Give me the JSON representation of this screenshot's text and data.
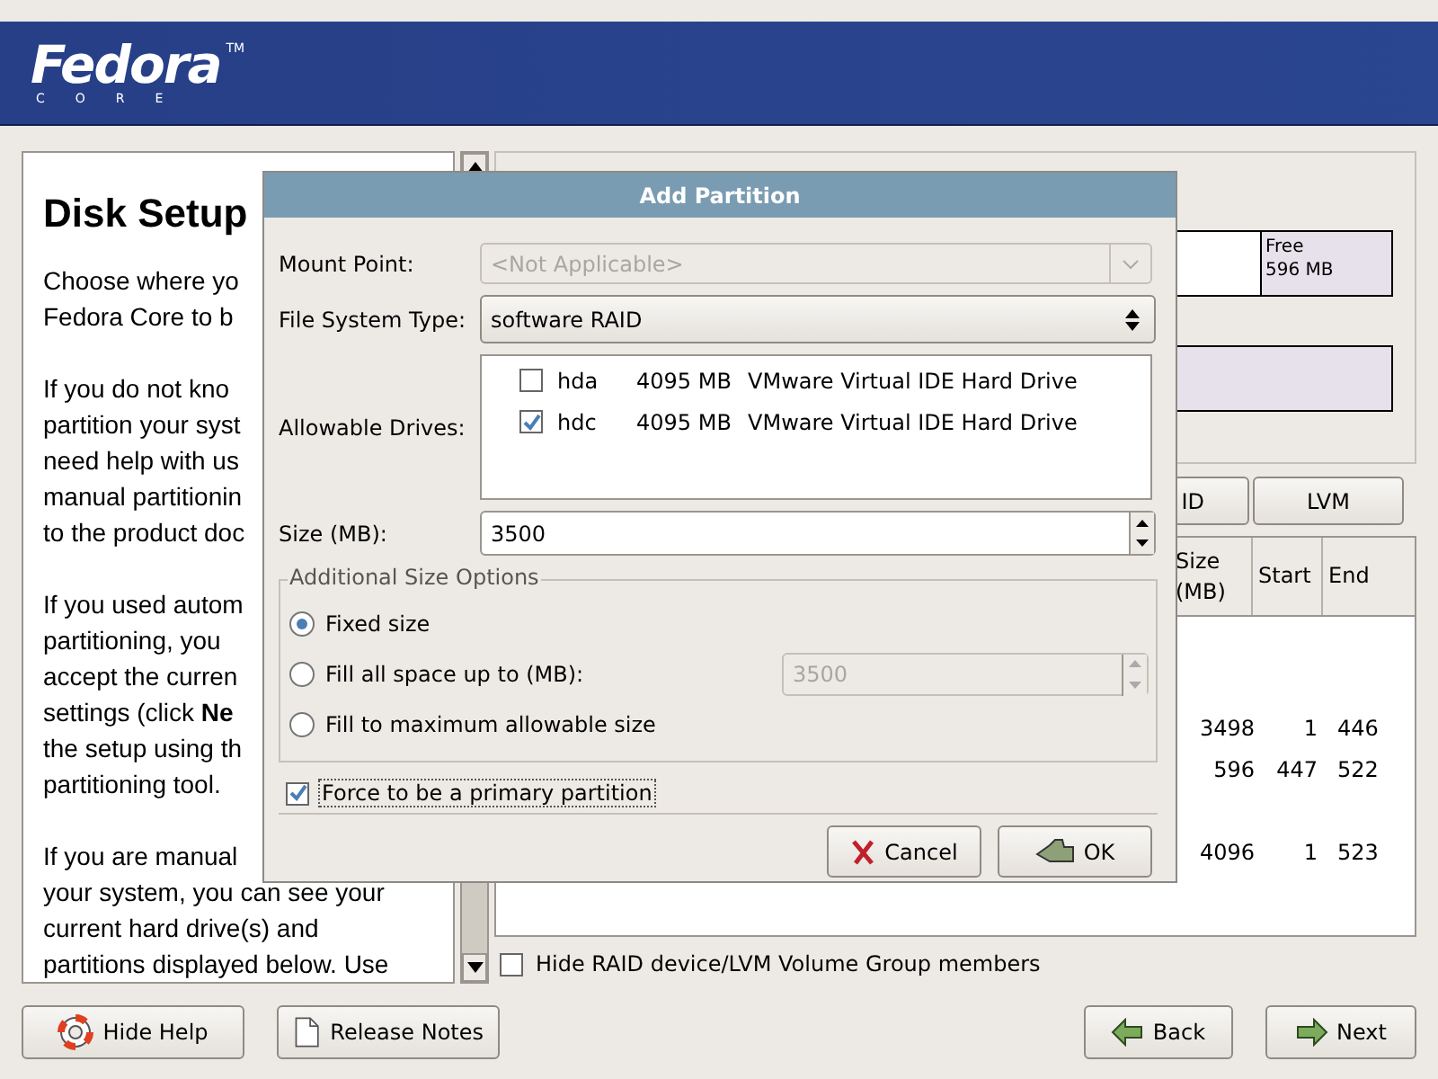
{
  "header": {
    "logo": "Fedora",
    "trademark": "TM",
    "subtitle": "CORE"
  },
  "help": {
    "title": "Disk Setup",
    "paragraphs": [
      [
        "Choose where yo",
        "Fedora Core to b"
      ],
      [
        "If you do not kno",
        "partition your syst",
        "need help with us",
        "manual partitionin",
        "to the product doc"
      ],
      [
        "If you used autom",
        "partitioning, you",
        "accept the curren",
        "settings (click **Ne**",
        "the setup using th",
        "partitioning tool."
      ],
      [
        "If you are manual",
        "your system, you can see your",
        "current hard drive(s) and",
        "partitions displayed below. Use"
      ]
    ]
  },
  "drive_map": {
    "free": {
      "label": "Free",
      "size": "596 MB"
    }
  },
  "editor_buttons": [
    "ID",
    "LVM"
  ],
  "table": {
    "columns": [
      "Size (MB)",
      "Start",
      "End"
    ],
    "rows": [
      [
        "3498",
        "1",
        "446"
      ],
      [
        "596",
        "447",
        "522"
      ],
      [
        "4096",
        "1",
        "523"
      ]
    ]
  },
  "hide_members": {
    "label": "Hide RAID device/LVM Volume Group members",
    "checked": false
  },
  "dialog": {
    "title": "Add Partition",
    "mount_point": {
      "label": "Mount Point:",
      "value": "<Not Applicable>",
      "disabled": true
    },
    "fs_type": {
      "label": "File System Type:",
      "value": "software RAID"
    },
    "drives": {
      "label": "Allowable Drives:",
      "items": [
        {
          "name": "hda",
          "size": "4095 MB",
          "model": "VMware Virtual IDE Hard Drive",
          "checked": false
        },
        {
          "name": "hdc",
          "size": "4095 MB",
          "model": "VMware Virtual IDE Hard Drive",
          "checked": true
        }
      ]
    },
    "size": {
      "label": "Size (MB):",
      "value": "3500"
    },
    "size_options": {
      "title": "Additional Size Options",
      "options": [
        {
          "label": "Fixed size",
          "selected": true
        },
        {
          "label": "Fill all space up to (MB):",
          "selected": false,
          "value": "3500",
          "disabled": true
        },
        {
          "label": "Fill to maximum allowable size",
          "selected": false
        }
      ]
    },
    "force_primary": {
      "label": "Force to be a primary partition",
      "checked": true
    },
    "buttons": [
      {
        "label": "Cancel",
        "kind": "cancel"
      },
      {
        "label": "OK",
        "kind": "ok"
      }
    ]
  },
  "footer": [
    {
      "label": "Hide Help",
      "kind": "help"
    },
    {
      "label": "Release Notes",
      "kind": "notes"
    },
    {
      "label": "Back",
      "kind": "back"
    },
    {
      "label": "Next",
      "kind": "next"
    }
  ]
}
